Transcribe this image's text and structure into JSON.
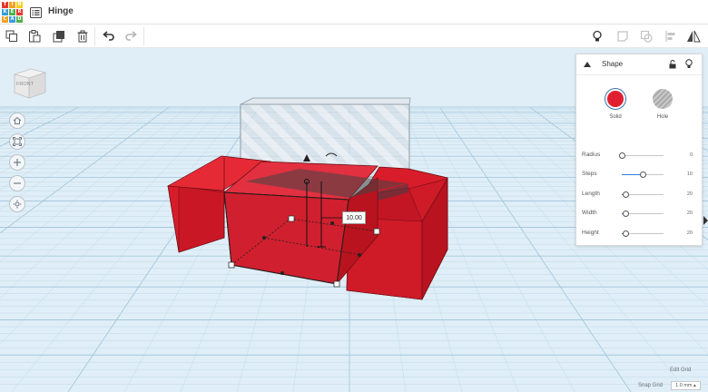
{
  "app": {
    "title": "Hinge",
    "logo_letters": [
      "T",
      "I",
      "N",
      "K",
      "E",
      "R",
      "C",
      "A",
      "D"
    ],
    "logo_colors": [
      "#e7372f",
      "#f4a020",
      "#f7cf1c",
      "#3a9bdc",
      "#4fb24d",
      "#e7372f",
      "#f4a020",
      "#3a9bdc",
      "#4fb24d"
    ]
  },
  "toolbar": {
    "left_icons": [
      "copy-icon",
      "paste-icon",
      "duplicate-icon",
      "delete-icon",
      "undo-icon",
      "redo-icon"
    ],
    "right_icons": [
      "lightbulb-icon",
      "note-icon",
      "group-icon",
      "align-icon",
      "mirror-icon"
    ]
  },
  "viewcube": {
    "face_label": "FRONT"
  },
  "nav": [
    "home-icon",
    "fit-icon",
    "zoom-in-icon",
    "zoom-out-icon",
    "orbit-icon"
  ],
  "dimension": {
    "value": "10.00"
  },
  "shape_panel": {
    "title": "Shape",
    "solid_label": "Solid",
    "hole_label": "Hole",
    "solid_color": "#e02030",
    "properties": [
      {
        "label": "Radius",
        "value": "0",
        "fraction": 0.0
      },
      {
        "label": "Steps",
        "value": "10",
        "fraction": 0.5
      },
      {
        "label": "Length",
        "value": "20",
        "fraction": 0.1
      },
      {
        "label": "Width",
        "value": "20",
        "fraction": 0.1
      },
      {
        "label": "Height",
        "value": "20",
        "fraction": 0.1
      }
    ]
  },
  "footer": {
    "edit_grid": "Edit Grid",
    "snap_grid": "Snap Grid",
    "snap_value": "1.0 mm"
  }
}
